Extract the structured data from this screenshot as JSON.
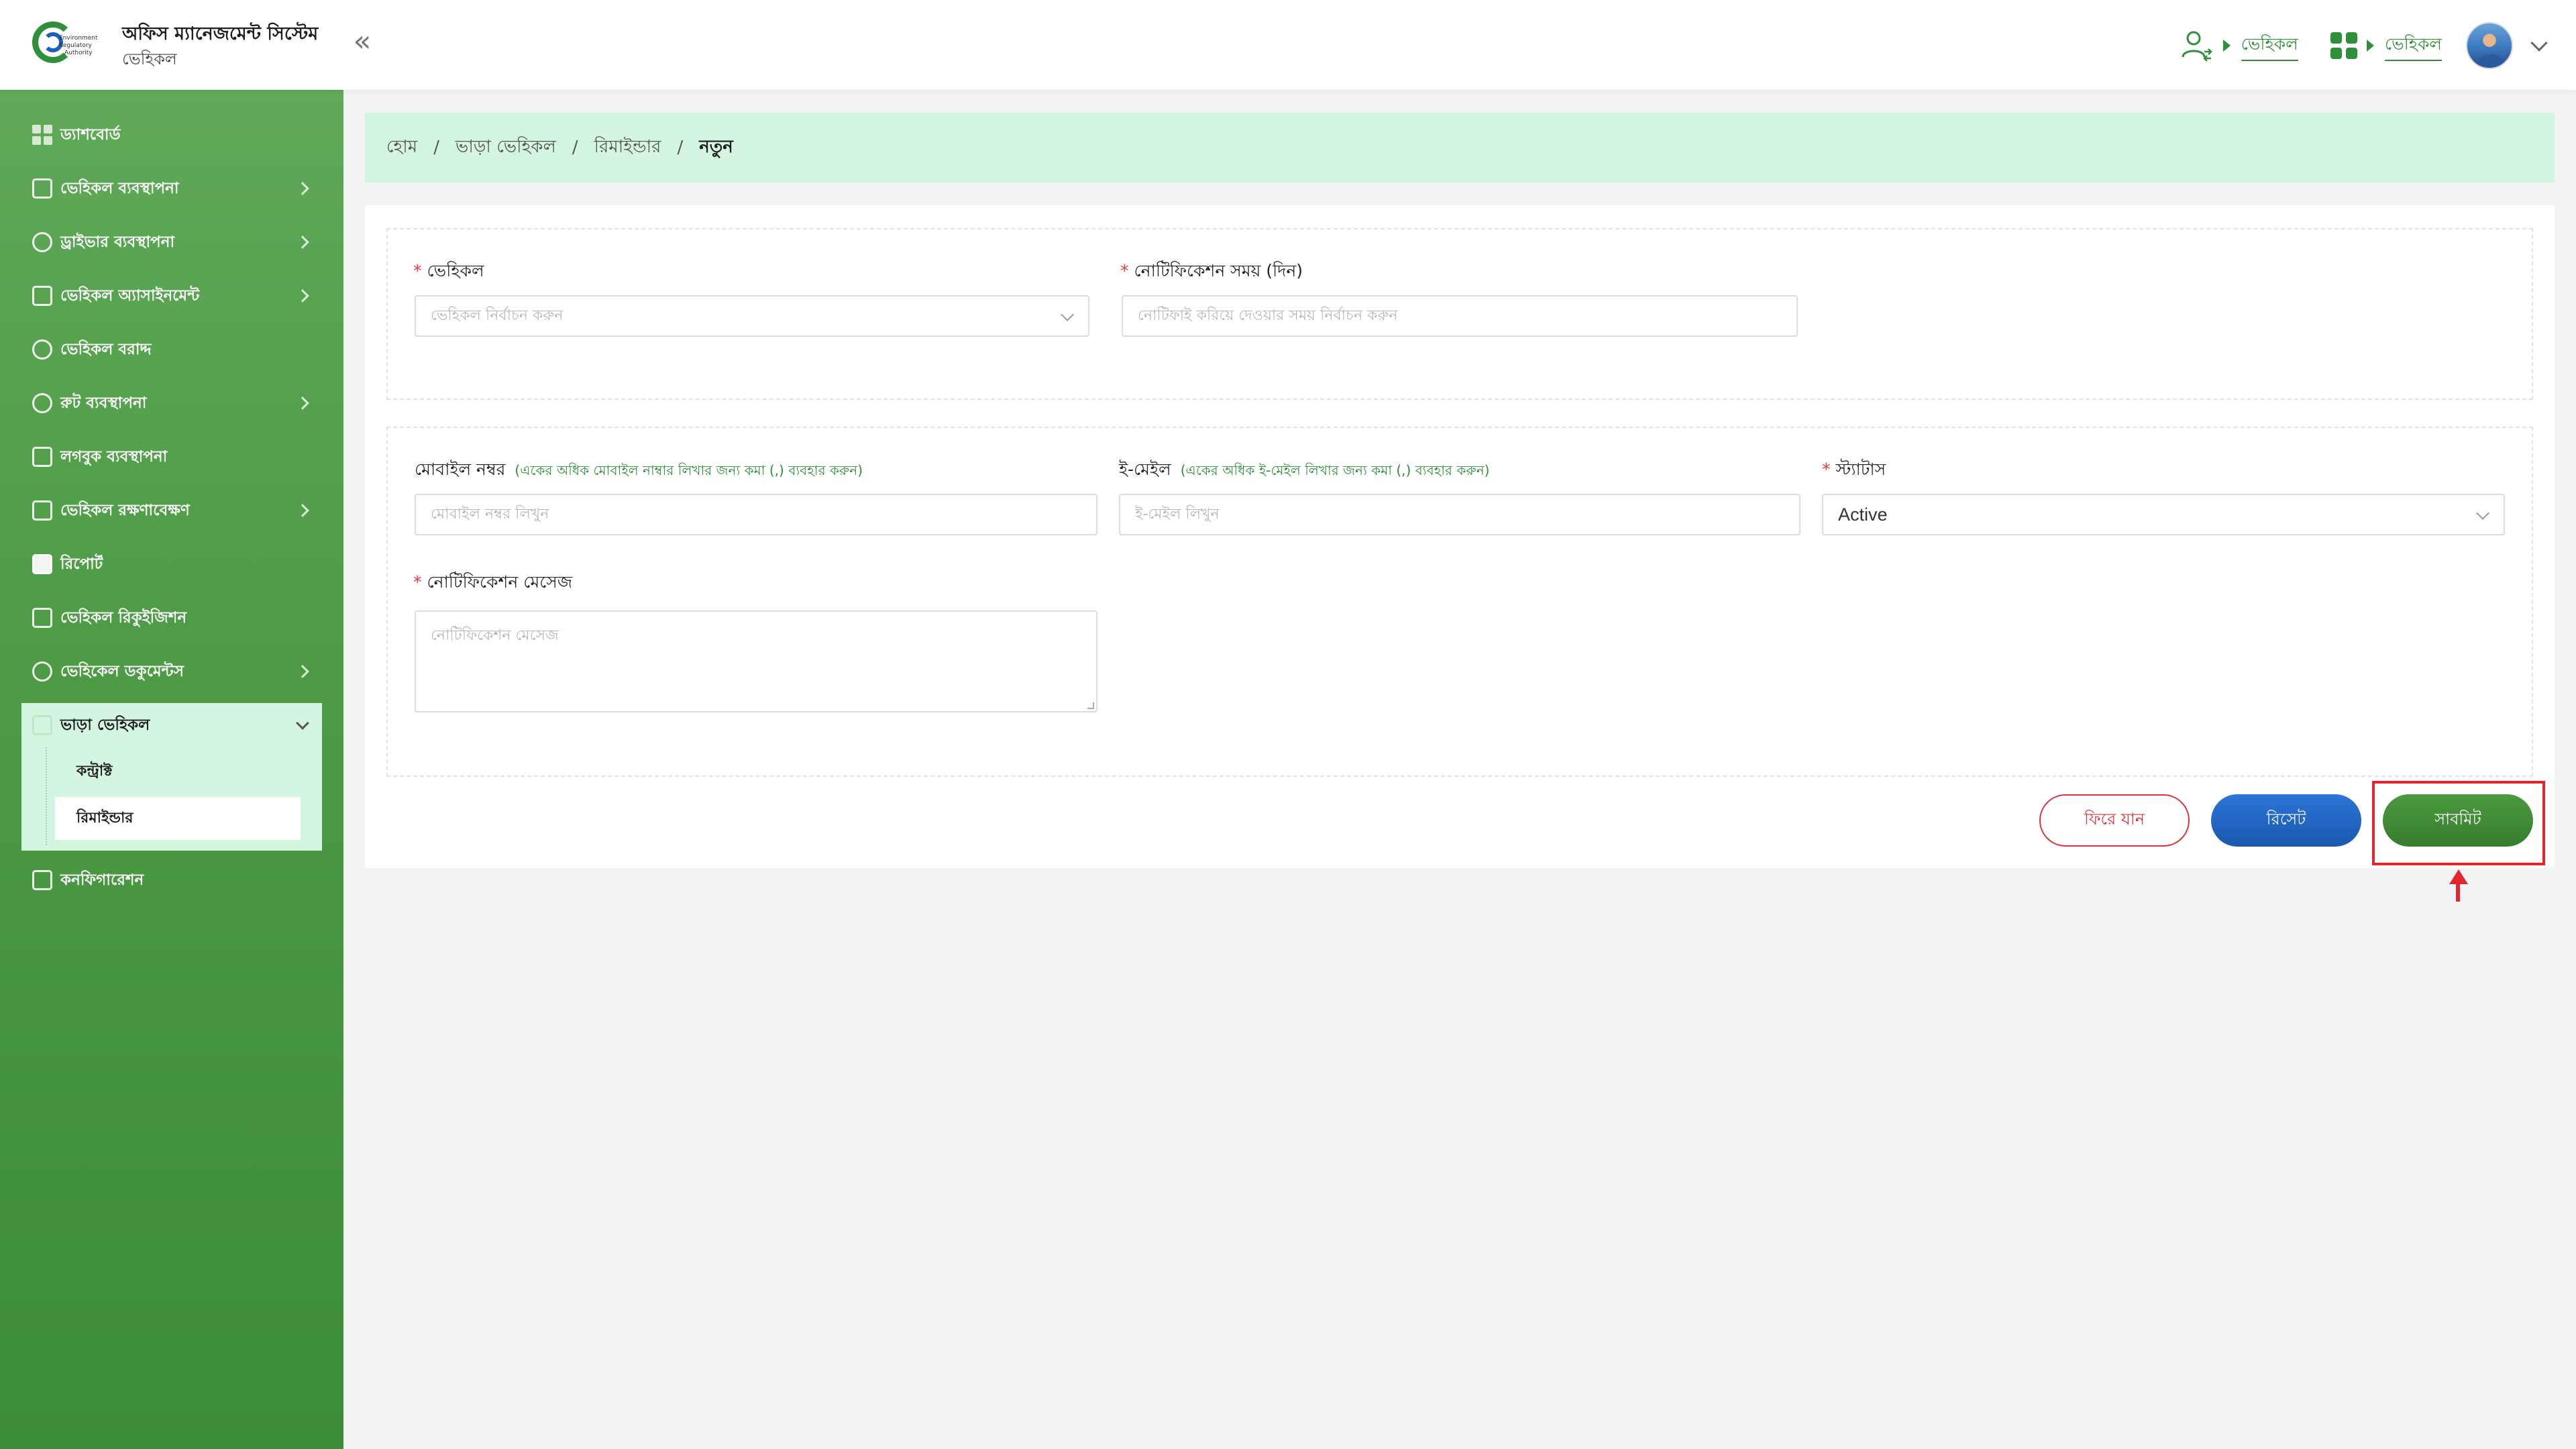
{
  "header": {
    "logo_text": [
      "Environment",
      "Regulatory",
      "Authority"
    ],
    "app_title": "অফিস ম্যানেজমেন্ট সিস্টেম",
    "app_subtitle": "ভেহিকল",
    "collapse_symbol": "«",
    "user_link": "ভেহিকল",
    "module_link": "ভেহিকল",
    "icons": [
      "user-switch-icon",
      "apps-grid-icon",
      "avatar",
      "chevron-down-icon"
    ]
  },
  "sidebar": {
    "items": [
      {
        "label": "ড্যাশবোর্ড",
        "icon": "dashboard-icon",
        "has_children": false
      },
      {
        "label": "ভেহিকল ব্যবস্থাপনা",
        "icon": "vehicle-icon",
        "has_children": true
      },
      {
        "label": "ড্রাইভার ব্যবস্থাপনা",
        "icon": "driver-icon",
        "has_children": true
      },
      {
        "label": "ভেহিকল অ্যাসাইনমেন্ট",
        "icon": "assignment-icon",
        "has_children": true
      },
      {
        "label": "ভেহিকল বরাদ্দ",
        "icon": "allocation-icon",
        "has_children": false
      },
      {
        "label": "রুট ব্যবস্থাপনা",
        "icon": "route-icon",
        "has_children": true
      },
      {
        "label": "লগবুক ব্যবস্থাপনা",
        "icon": "logbook-icon",
        "has_children": false
      },
      {
        "label": "ভেহিকল রক্ষণাবেক্ষণ",
        "icon": "maintenance-icon",
        "has_children": true
      },
      {
        "label": "রিপোর্ট",
        "icon": "report-icon",
        "has_children": false
      },
      {
        "label": "ভেহিকল রিকুইজিশন",
        "icon": "requisition-icon",
        "has_children": false
      },
      {
        "label": "ভেহিকেল ডকুমেন্টস",
        "icon": "documents-icon",
        "has_children": true
      }
    ],
    "open_group": {
      "label": "ভাড়া ভেহিকল",
      "icon": "rent-vehicle-icon",
      "children": [
        "কন্ট্রাক্ট",
        "রিমাইন্ডার"
      ],
      "active_child": "রিমাইন্ডার"
    },
    "config_item": {
      "label": "কনফিগারেশন",
      "icon": "configuration-icon"
    }
  },
  "breadcrumb": {
    "items": [
      "হোম",
      "ভাড়া ভেহিকল",
      "রিমাইন্ডার"
    ],
    "current": "নতুন",
    "separator": "/"
  },
  "form": {
    "vehicle": {
      "label": "ভেহিকল",
      "placeholder": "ভেহিকল নির্বাচন করুন",
      "required": true
    },
    "notify_time": {
      "label": "নোটিফিকেশন সময় (দিন)",
      "placeholder": "নোটিফাই করিয়ে দেওয়ার সময় নির্বাচন করুন",
      "required": true
    },
    "mobile": {
      "label": "মোবাইল নম্বর",
      "hint": "(একের অধিক মোবাইল নাম্বার লিখার জন্য কমা (,) ব্যবহার করুন)",
      "placeholder": "মোবাইল নম্বর লিখুন"
    },
    "email": {
      "label": "ই-মেইল",
      "hint": "(একের অধিক ই-মেইল লিখার জন্য কমা (,) ব্যবহার করুন)",
      "placeholder": "ই-মেইল লিখুন"
    },
    "status": {
      "label": "স্ট্যাটাস",
      "value": "Active",
      "required": true
    },
    "message": {
      "label": "নোটিফিকেশন মেসেজ",
      "placeholder": "নোটিফিকেশন মেসেজ",
      "required": true
    },
    "required_mark": "*"
  },
  "actions": {
    "back_label": "ফিরে যান",
    "reset_label": "রিসেট",
    "submit_label": "সাবমিট"
  },
  "colors": {
    "sidebar_green": "#4c9a44",
    "accent_green": "#2f8f3a",
    "breadcrumb_bg": "#d4f5df",
    "reset_blue": "#1f63c4",
    "back_red": "#d9343c",
    "highlight_red": "#e3262d"
  }
}
